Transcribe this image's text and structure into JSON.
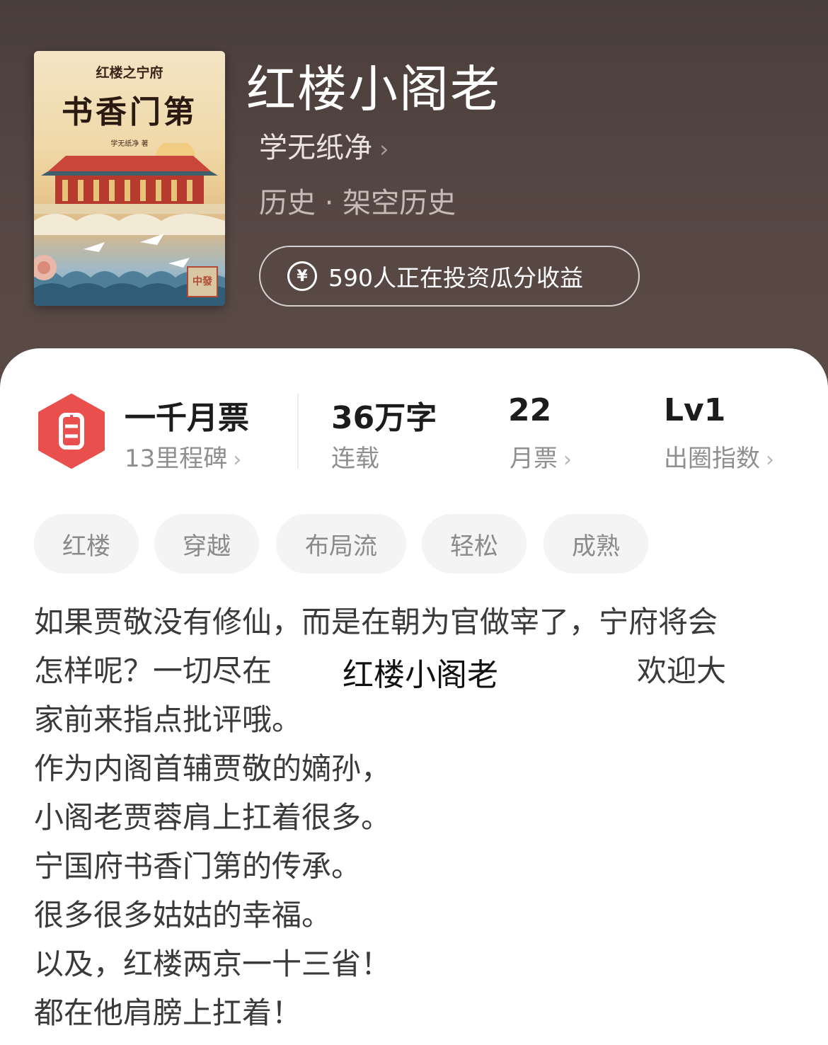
{
  "book": {
    "title": "红楼小阁老",
    "author": "学无纸净",
    "category": "历史 · 架空历史",
    "invest_text": "590人正在投资瓜分收益",
    "cover": {
      "subtitle": "红楼之宁府",
      "title": "书香门第",
      "author_line": "学无纸净 著",
      "corner_text": "中發"
    }
  },
  "stats": {
    "milestone_title": "一千月票",
    "milestone_sub": "13里程碑",
    "words_value": "36万字",
    "words_label": "连载",
    "monthly_value": "22",
    "monthly_label": "月票",
    "level_value": "Lv1",
    "level_label": "出圈指数"
  },
  "tags": [
    "红楼",
    "穿越",
    "布局流",
    "轻松",
    "成熟"
  ],
  "description": {
    "line1": "如果贾敬没有修仙，而是在朝为官做宰了，宁府将会",
    "line2_a": "怎样呢？一切尽在",
    "line2_title": "红楼小阁老",
    "line2_b": "欢迎大",
    "line3": "家前来指点批评哦。",
    "line4": "作为内阁首辅贾敬的嫡孙，",
    "line5": "小阁老贾蓉肩上扛着很多。",
    "line6": "宁国府书香门第的传承。",
    "line7": "很多很多姑姑的幸福。",
    "line8": "以及，红楼两京一十三省！",
    "line9": "都在他肩膀上扛着！"
  },
  "colors": {
    "header_bg": "#514541",
    "badge_red": "#e9504d",
    "card_bg": "#ffffff",
    "tag_bg": "#f4f4f4"
  }
}
